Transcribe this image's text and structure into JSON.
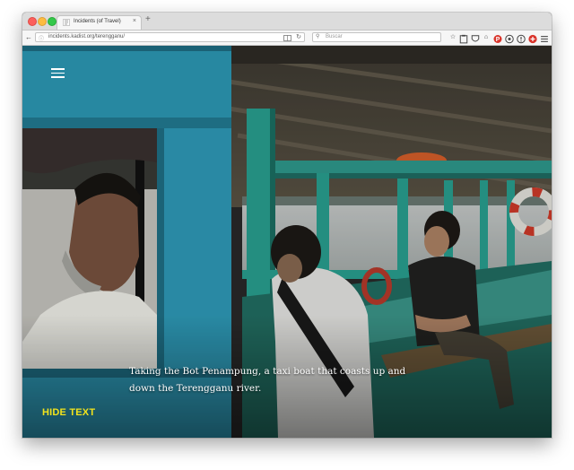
{
  "browser": {
    "tab_title": "Incidents (of Travel)",
    "tab_close_glyph": "×",
    "new_tab_glyph": "+",
    "url": "incidents.kadist.org/terengganu/",
    "search_placeholder": "Buscar"
  },
  "page": {
    "menu_icon": "hamburger-menu-icon",
    "caption": "Taking the Bot Penampung, a taxi boat that coasts up and down the Terengganu river.",
    "hide_text_label": "HIDE TEXT",
    "accent_color": "#f2e31c"
  }
}
